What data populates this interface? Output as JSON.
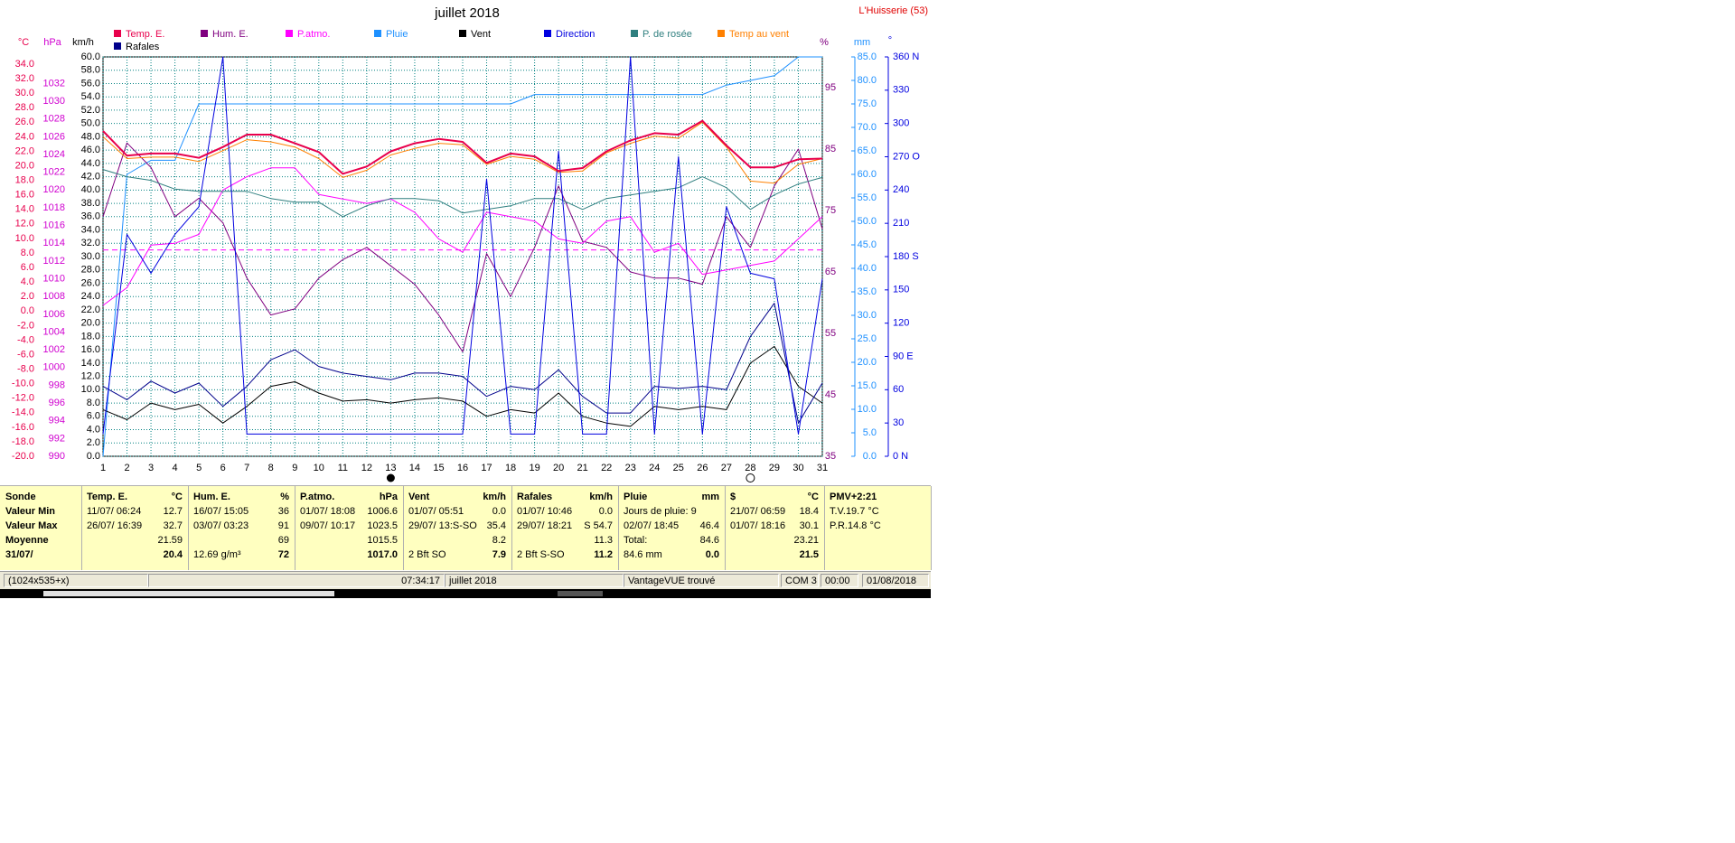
{
  "title": "juillet 2018",
  "station": "L'Huisserie (53)",
  "axis_units": {
    "temp": "°C",
    "press": "hPa",
    "wind": "km/h",
    "hum": "%",
    "rain": "mm",
    "dir": "°"
  },
  "legend": [
    {
      "label": "Temp. E.",
      "color": "#e8004c"
    },
    {
      "label": "Hum. E.",
      "color": "#800080"
    },
    {
      "label": "P.atmo.",
      "color": "#ff00ff"
    },
    {
      "label": "Pluie",
      "color": "#1e90ff"
    },
    {
      "label": "Vent",
      "color": "#000000"
    },
    {
      "label": "Direction",
      "color": "#0000e0"
    },
    {
      "label": "P. de rosée",
      "color": "#2f7f7f"
    },
    {
      "label": "Temp au vent",
      "color": "#ff8000"
    },
    {
      "label": "Rafales",
      "color": "#00008b"
    }
  ],
  "colors": {
    "grid": "#008080",
    "temp_axis": "#e8004c",
    "press_axis": "#d000d0",
    "hum_axis": "#800080",
    "rain_axis": "#1e90ff",
    "dir_axis": "#0000e0",
    "pressure_ref": "#ff00ff"
  },
  "chart_data": {
    "type": "line",
    "title": "juillet 2018",
    "x": [
      1,
      2,
      3,
      4,
      5,
      6,
      7,
      8,
      9,
      10,
      11,
      12,
      13,
      14,
      15,
      16,
      17,
      18,
      19,
      20,
      21,
      22,
      23,
      24,
      25,
      26,
      27,
      28,
      29,
      30,
      31
    ],
    "xlim": [
      1,
      31
    ],
    "axes": {
      "wind": {
        "unit": "km/h",
        "range": [
          0,
          60
        ],
        "ticks": [
          "0.0",
          "2.0",
          "4.0",
          "6.0",
          "8.0",
          "10.0",
          "12.0",
          "14.0",
          "16.0",
          "18.0",
          "20.0",
          "22.0",
          "24.0",
          "26.0",
          "28.0",
          "30.0",
          "32.0",
          "34.0",
          "36.0",
          "38.0",
          "40.0",
          "42.0",
          "44.0",
          "46.0",
          "48.0",
          "50.0",
          "52.0",
          "54.0",
          "56.0",
          "58.0",
          "60.0"
        ]
      },
      "temp": {
        "unit": "°C",
        "range": [
          -20,
          35
        ],
        "ticks": [
          "-20.0",
          "-18.0",
          "-16.0",
          "-14.0",
          "-12.0",
          "-10.0",
          "-8.0",
          "-6.0",
          "-4.0",
          "-2.0",
          "0.0",
          "2.0",
          "4.0",
          "6.0",
          "8.0",
          "10.0",
          "12.0",
          "14.0",
          "16.0",
          "18.0",
          "20.0",
          "22.0",
          "24.0",
          "26.0",
          "28.0",
          "30.0",
          "32.0",
          "34.0"
        ]
      },
      "press": {
        "unit": "hPa",
        "range": [
          990,
          1035
        ],
        "ticks": [
          "990",
          "992",
          "994",
          "996",
          "998",
          "1000",
          "1002",
          "1004",
          "1006",
          "1008",
          "1010",
          "1012",
          "1014",
          "1016",
          "1018",
          "1020",
          "1022",
          "1024",
          "1026",
          "1028",
          "1030",
          "1032"
        ]
      },
      "hum": {
        "unit": "%",
        "range": [
          35,
          100
        ],
        "ticks": [
          "35",
          "45",
          "55",
          "65",
          "75",
          "85",
          "95"
        ]
      },
      "rain": {
        "unit": "mm",
        "range": [
          0,
          85
        ],
        "ticks": [
          "0.0",
          "5.0",
          "10.0",
          "15.0",
          "20.0",
          "25.0",
          "30.0",
          "35.0",
          "40.0",
          "45.0",
          "50.0",
          "55.0",
          "60.0",
          "65.0",
          "70.0",
          "75.0",
          "80.0",
          "85.0"
        ]
      },
      "dir": {
        "unit": "°",
        "range": [
          0,
          360
        ],
        "ticks": [
          "0",
          "30",
          "60",
          "90",
          "120",
          "150",
          "180",
          "210",
          "240",
          "270",
          "300",
          "330",
          "360"
        ],
        "labels": {
          "0": "N",
          "90": "E",
          "180": "S",
          "270": "O",
          "360": "N"
        }
      }
    },
    "pressure_ref": 1013.25,
    "series": [
      {
        "name": "Temp. E.",
        "axis": "temp",
        "color": "#e8004c",
        "width": 2,
        "values": [
          24.8,
          21.4,
          21.7,
          21.7,
          21.1,
          22.6,
          24.3,
          24.3,
          23.1,
          21.9,
          18.9,
          19.9,
          22.0,
          23.1,
          23.7,
          23.3,
          20.4,
          21.7,
          21.3,
          19.3,
          19.7,
          22.0,
          23.5,
          24.5,
          24.3,
          26.2,
          22.8,
          19.8,
          19.8,
          20.9,
          21.0
        ]
      },
      {
        "name": "Temp au vent",
        "axis": "temp",
        "color": "#ff8000",
        "width": 1,
        "values": [
          24.0,
          21.0,
          21.2,
          21.2,
          20.6,
          22.1,
          23.6,
          23.3,
          22.6,
          21.0,
          18.4,
          19.4,
          21.5,
          22.4,
          23.1,
          22.9,
          20.2,
          21.3,
          20.9,
          19.1,
          19.3,
          21.8,
          23.1,
          24.1,
          23.8,
          26.0,
          22.6,
          17.9,
          17.6,
          20.2,
          21.0
        ]
      },
      {
        "name": "Hum. E.",
        "axis": "hum",
        "color": "#800080",
        "width": 1,
        "values": [
          74.0,
          86.0,
          82.0,
          74.0,
          77.0,
          73.0,
          64.0,
          58.0,
          59.0,
          64.0,
          67.0,
          69.0,
          66.0,
          63.0,
          58.0,
          52.0,
          68.0,
          61.0,
          69.0,
          79.0,
          70.0,
          69.0,
          65.0,
          64.0,
          64.0,
          63.0,
          74.0,
          69.0,
          79.0,
          85.0,
          72.0
        ]
      },
      {
        "name": "P.atmo.",
        "axis": "press",
        "color": "#ff00ff",
        "width": 1,
        "values": [
          1007.0,
          1009.0,
          1013.8,
          1014.0,
          1015.0,
          1020.0,
          1021.5,
          1022.5,
          1022.5,
          1019.5,
          1019.0,
          1018.5,
          1019.0,
          1017.5,
          1014.5,
          1013.0,
          1017.5,
          1017.0,
          1016.5,
          1014.5,
          1014.0,
          1016.5,
          1017.0,
          1013.0,
          1014.0,
          1010.5,
          1011.0,
          1011.5,
          1012.0,
          1014.5,
          1017.0
        ]
      },
      {
        "name": "P. de rosée",
        "axis": "temp",
        "color": "#2f7f7f",
        "width": 1,
        "values": [
          19.5,
          18.5,
          18.0,
          16.8,
          16.5,
          16.5,
          16.5,
          15.5,
          15.0,
          15.0,
          13.0,
          14.5,
          15.5,
          15.5,
          15.2,
          13.5,
          14.0,
          14.5,
          15.5,
          15.5,
          14.0,
          15.5,
          16.0,
          16.5,
          17.0,
          18.5,
          17.0,
          14.0,
          16.0,
          17.5,
          18.4
        ]
      },
      {
        "name": "Pluie",
        "axis": "rain",
        "color": "#1e90ff",
        "width": 1,
        "values": [
          0.0,
          60.0,
          63.0,
          63.0,
          75.0,
          75.0,
          75.0,
          75.0,
          75.0,
          75.0,
          75.0,
          75.0,
          75.0,
          75.0,
          75.0,
          75.0,
          75.0,
          75.0,
          77.0,
          77.0,
          77.0,
          77.0,
          77.0,
          77.0,
          77.0,
          77.0,
          79.0,
          80.0,
          81.0,
          85.0,
          85.0
        ]
      },
      {
        "name": "Vent",
        "axis": "wind",
        "color": "#000000",
        "width": 1,
        "values": [
          7.0,
          5.5,
          8.0,
          7.0,
          7.8,
          5.0,
          7.5,
          10.5,
          11.2,
          9.5,
          8.3,
          8.5,
          8.0,
          8.5,
          8.8,
          8.3,
          6.0,
          7.0,
          6.5,
          9.5,
          6.0,
          5.0,
          4.5,
          7.5,
          7.0,
          7.5,
          7.0,
          14.0,
          16.5,
          10.5,
          8.0
        ]
      },
      {
        "name": "Rafales",
        "axis": "wind",
        "color": "#00008b",
        "width": 1,
        "values": [
          10.5,
          8.5,
          11.3,
          9.5,
          11.0,
          7.5,
          10.5,
          14.5,
          16.0,
          13.5,
          12.5,
          12.0,
          11.5,
          12.5,
          12.5,
          12.0,
          9.0,
          10.5,
          10.0,
          13.0,
          9.0,
          6.5,
          6.5,
          10.5,
          10.2,
          10.5,
          10.0,
          18.0,
          23.0,
          5.0,
          11.0
        ]
      },
      {
        "name": "Direction",
        "axis": "dir",
        "color": "#0000e0",
        "width": 1,
        "values": [
          20,
          200,
          165,
          200,
          225,
          360,
          20,
          20,
          20,
          20,
          20,
          20,
          20,
          20,
          20,
          20,
          250,
          20,
          20,
          275,
          20,
          20,
          360,
          20,
          270,
          20,
          225,
          165,
          160,
          20,
          160
        ]
      }
    ]
  },
  "table": {
    "row_labels": [
      "Sonde",
      "Valeur Min",
      "Valeur Max",
      "Moyenne",
      "31/07/"
    ],
    "cols": [
      {
        "title": "Temp. E.",
        "unit": "°C",
        "min": {
          "date": "11/07/  06:24",
          "val": "12.7"
        },
        "max": {
          "date": "26/07/  16:39",
          "val": "32.7"
        },
        "avg": {
          "left": "",
          "val": "21.59"
        },
        "cur": {
          "left": "",
          "val": "20.4"
        }
      },
      {
        "title": "Hum. E.",
        "unit": "%",
        "min": {
          "date": "16/07/  15:05",
          "val": "36"
        },
        "max": {
          "date": "03/07/  03:23",
          "val": "91"
        },
        "avg": {
          "left": "",
          "val": "69"
        },
        "cur": {
          "left": "12.69 g/m³",
          "val": "72"
        }
      },
      {
        "title": "P.atmo.",
        "unit": "hPa",
        "min": {
          "date": "01/07/  18:08",
          "val": "1006.6"
        },
        "max": {
          "date": "09/07/  10:17",
          "val": "1023.5"
        },
        "avg": {
          "left": "",
          "val": "1015.5"
        },
        "cur": {
          "left": "",
          "val": "1017.0"
        }
      },
      {
        "title": "Vent",
        "unit": "km/h",
        "min": {
          "date": "01/07/  05:51",
          "val": "0.0"
        },
        "max": {
          "date": "29/07/  13:S-SO",
          "val": "35.4"
        },
        "avg": {
          "left": "",
          "val": "8.2"
        },
        "cur": {
          "left": "2 Bft SO",
          "val": "7.9"
        }
      },
      {
        "title": "Rafales",
        "unit": "km/h",
        "min": {
          "date": "01/07/  10:46",
          "val": "0.0"
        },
        "max": {
          "date": "29/07/  18:21",
          "val": "S 54.7"
        },
        "avg": {
          "left": "",
          "val": "11.3"
        },
        "cur": {
          "left": "2 Bft S-SO",
          "val": "11.2"
        }
      },
      {
        "title": "Pluie",
        "unit": "mm",
        "min": {
          "date": "Jours de pluie: 9",
          "val": ""
        },
        "max": {
          "date": "02/07/  18:45",
          "val": "46.4"
        },
        "avg": {
          "left": "Total:",
          "val": "84.6"
        },
        "cur": {
          "left": "84.6 mm",
          "val": "0.0"
        }
      },
      {
        "title": "$",
        "unit": "°C",
        "min": {
          "date": "21/07/  06:59",
          "val": "18.4"
        },
        "max": {
          "date": "01/07/  18:16",
          "val": "30.1"
        },
        "avg": {
          "left": "",
          "val": "23.21"
        },
        "cur": {
          "left": "",
          "val": "21.5"
        }
      },
      {
        "title": "PMV+2:21",
        "unit": "",
        "min": {
          "date": "T.V.19.7 °C",
          "val": ""
        },
        "max": {
          "date": "P.R.14.8 °C",
          "val": ""
        },
        "avg": {
          "left": "",
          "val": ""
        },
        "cur": {
          "left": "",
          "val": ""
        }
      }
    ]
  },
  "statusbar": {
    "size": "(1024x535+x)",
    "time": "07:34:17",
    "period": "juillet 2018",
    "device": "VantageVUE trouvé",
    "port": "COM 3",
    "hour": "00:00",
    "date": "01/08/2018"
  }
}
